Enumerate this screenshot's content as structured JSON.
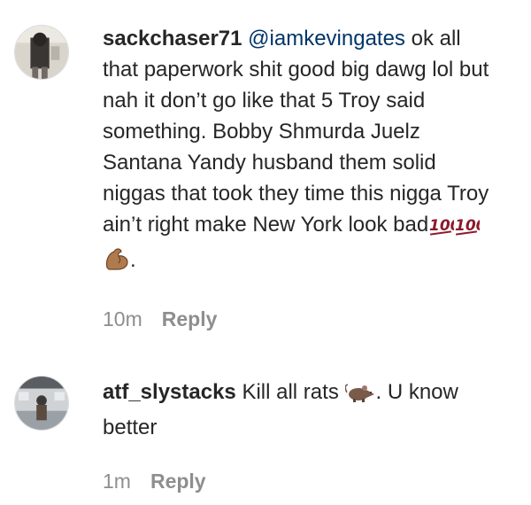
{
  "comments": [
    {
      "username": "sackchaser71",
      "mention": "@iamkevingates",
      "body_before_emoji": "ok all that paperwork shit good big dawg lol but nah it don’t go like that 5 Troy said something. Bobby Shmurda Juelz Santana Yandy husband them solid niggas that took they time this nigga Troy ain’t right make New York look bad",
      "emojis": [
        "hundred-points-icon",
        "hundred-points-icon",
        "flexed-biceps-icon"
      ],
      "body_after_emoji": ".",
      "time": "10m",
      "reply_label": "Reply"
    },
    {
      "username": "atf_slystacks",
      "body_before_emoji": "Kill all rats",
      "emojis": [
        "rat-icon"
      ],
      "body_after_emoji": ". U know better",
      "time": "1m",
      "reply_label": "Reply"
    }
  ],
  "colors": {
    "text": "#262626",
    "mention": "#003569",
    "meta": "#8e8e8e",
    "hundred": "#8b1a2b",
    "flex": "#b07a4f",
    "rat": "#7a5a4a"
  }
}
